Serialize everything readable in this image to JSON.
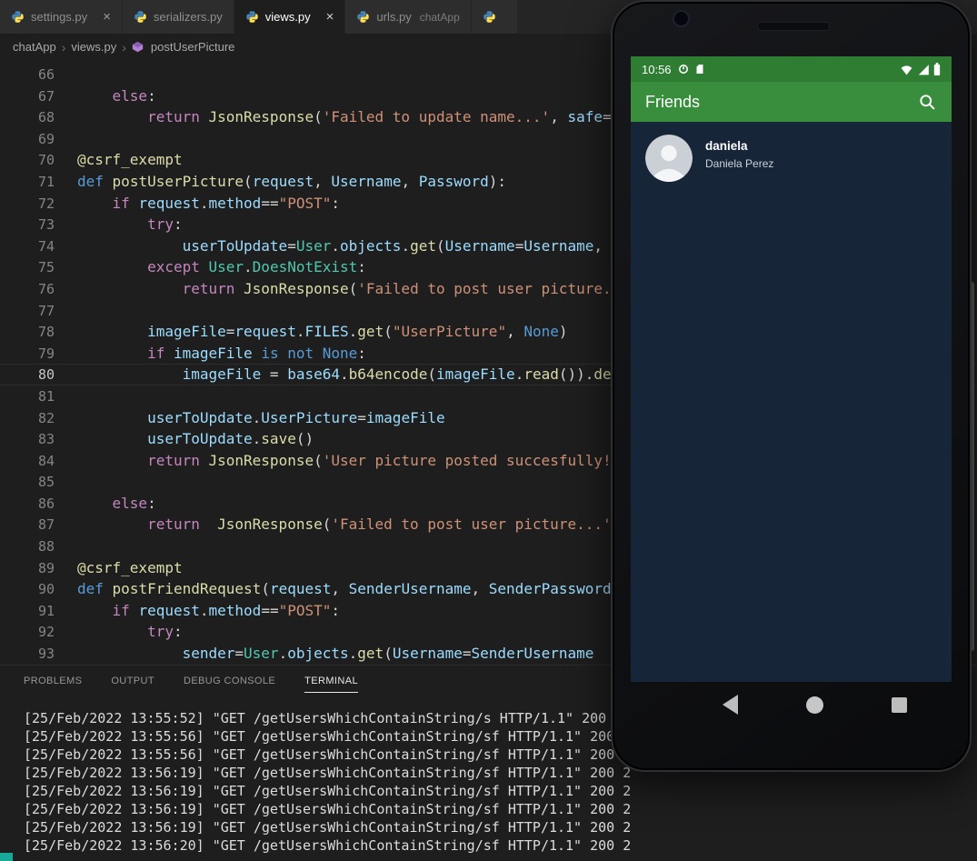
{
  "colors": {
    "editor_bg": "#1E1E1E",
    "tabbar_bg": "#252526",
    "inactive_tab_bg": "#2D2D2D",
    "phone_header_green": "#388E3C",
    "phone_status_green": "#2E7D32",
    "phone_screen_bg": "#172539",
    "terminal_text": "#DCDCDC",
    "status_accent_teal": "#18A999"
  },
  "tabs": [
    {
      "label": "settings.py",
      "active": false,
      "close": true
    },
    {
      "label": "serializers.py",
      "active": false,
      "close": false
    },
    {
      "label": "views.py",
      "active": true,
      "close": true
    },
    {
      "label": "urls.py",
      "hint": "chatApp",
      "active": false,
      "close": false
    },
    {
      "label": "",
      "active": false,
      "close": false
    }
  ],
  "breadcrumb": {
    "items": [
      "chatApp",
      "views.py",
      "postUserPicture"
    ]
  },
  "editor": {
    "current_line": 80,
    "token_colors": {
      "kw": "#C586C0",
      "def": "#569CD6",
      "fn": "#DCDCAA",
      "var": "#9CDCFE",
      "str": "#CE9178",
      "cls": "#4EC9B0",
      "plain": "#D4D4D4"
    },
    "lines": [
      {
        "num": 66,
        "tokens": []
      },
      {
        "num": 67,
        "tokens": [
          [
            "plain",
            "    "
          ],
          [
            "kw",
            "else"
          ],
          [
            "plain",
            ":"
          ]
        ]
      },
      {
        "num": 68,
        "tokens": [
          [
            "plain",
            "        "
          ],
          [
            "kw",
            "return"
          ],
          [
            "plain",
            " "
          ],
          [
            "fn",
            "JsonResponse"
          ],
          [
            "plain",
            "("
          ],
          [
            "str",
            "'Failed to update name...'"
          ],
          [
            "plain",
            ", "
          ],
          [
            "var",
            "safe"
          ],
          [
            "plain",
            "="
          ]
        ]
      },
      {
        "num": 69,
        "tokens": []
      },
      {
        "num": 70,
        "tokens": [
          [
            "fn",
            "@csrf_exempt"
          ]
        ]
      },
      {
        "num": 71,
        "tokens": [
          [
            "def",
            "def"
          ],
          [
            "plain",
            " "
          ],
          [
            "fn",
            "postUserPicture"
          ],
          [
            "plain",
            "("
          ],
          [
            "var",
            "request"
          ],
          [
            "plain",
            ", "
          ],
          [
            "var",
            "Username"
          ],
          [
            "plain",
            ", "
          ],
          [
            "var",
            "Password"
          ],
          [
            "plain",
            "):"
          ]
        ]
      },
      {
        "num": 72,
        "tokens": [
          [
            "plain",
            "    "
          ],
          [
            "kw",
            "if"
          ],
          [
            "plain",
            " "
          ],
          [
            "var",
            "request"
          ],
          [
            "plain",
            "."
          ],
          [
            "var",
            "method"
          ],
          [
            "plain",
            "=="
          ],
          [
            "str",
            "\"POST\""
          ],
          [
            "plain",
            ":"
          ]
        ]
      },
      {
        "num": 73,
        "tokens": [
          [
            "plain",
            "        "
          ],
          [
            "kw",
            "try"
          ],
          [
            "plain",
            ":"
          ]
        ]
      },
      {
        "num": 74,
        "tokens": [
          [
            "plain",
            "            "
          ],
          [
            "var",
            "userToUpdate"
          ],
          [
            "plain",
            "="
          ],
          [
            "cls",
            "User"
          ],
          [
            "plain",
            "."
          ],
          [
            "var",
            "objects"
          ],
          [
            "plain",
            "."
          ],
          [
            "fn",
            "get"
          ],
          [
            "plain",
            "("
          ],
          [
            "var",
            "Username"
          ],
          [
            "plain",
            "="
          ],
          [
            "var",
            "Username"
          ],
          [
            "plain",
            ","
          ]
        ]
      },
      {
        "num": 75,
        "tokens": [
          [
            "plain",
            "        "
          ],
          [
            "kw",
            "except"
          ],
          [
            "plain",
            " "
          ],
          [
            "cls",
            "User"
          ],
          [
            "plain",
            "."
          ],
          [
            "cls",
            "DoesNotExist"
          ],
          [
            "plain",
            ":"
          ]
        ]
      },
      {
        "num": 76,
        "tokens": [
          [
            "plain",
            "            "
          ],
          [
            "kw",
            "return"
          ],
          [
            "plain",
            " "
          ],
          [
            "fn",
            "JsonResponse"
          ],
          [
            "plain",
            "("
          ],
          [
            "str",
            "'Failed to post user picture."
          ]
        ]
      },
      {
        "num": 77,
        "tokens": []
      },
      {
        "num": 78,
        "tokens": [
          [
            "plain",
            "        "
          ],
          [
            "var",
            "imageFile"
          ],
          [
            "plain",
            "="
          ],
          [
            "var",
            "request"
          ],
          [
            "plain",
            "."
          ],
          [
            "var",
            "FILES"
          ],
          [
            "plain",
            "."
          ],
          [
            "fn",
            "get"
          ],
          [
            "plain",
            "("
          ],
          [
            "str",
            "\"UserPicture\""
          ],
          [
            "plain",
            ", "
          ],
          [
            "def",
            "None"
          ],
          [
            "plain",
            ")"
          ]
        ]
      },
      {
        "num": 79,
        "tokens": [
          [
            "plain",
            "        "
          ],
          [
            "kw",
            "if"
          ],
          [
            "plain",
            " "
          ],
          [
            "var",
            "imageFile"
          ],
          [
            "plain",
            " "
          ],
          [
            "def",
            "is"
          ],
          [
            "plain",
            " "
          ],
          [
            "def",
            "not"
          ],
          [
            "plain",
            " "
          ],
          [
            "def",
            "None"
          ],
          [
            "plain",
            ":"
          ]
        ]
      },
      {
        "num": 80,
        "tokens": [
          [
            "plain",
            "            "
          ],
          [
            "var",
            "imageFile"
          ],
          [
            "plain",
            " = "
          ],
          [
            "var",
            "base64"
          ],
          [
            "plain",
            "."
          ],
          [
            "fn",
            "b64encode"
          ],
          [
            "plain",
            "("
          ],
          [
            "var",
            "imageFile"
          ],
          [
            "plain",
            "."
          ],
          [
            "fn",
            "read"
          ],
          [
            "plain",
            "())."
          ],
          [
            "fn",
            "de"
          ]
        ]
      },
      {
        "num": 81,
        "tokens": []
      },
      {
        "num": 82,
        "tokens": [
          [
            "plain",
            "        "
          ],
          [
            "var",
            "userToUpdate"
          ],
          [
            "plain",
            "."
          ],
          [
            "var",
            "UserPicture"
          ],
          [
            "plain",
            "="
          ],
          [
            "var",
            "imageFile"
          ]
        ]
      },
      {
        "num": 83,
        "tokens": [
          [
            "plain",
            "        "
          ],
          [
            "var",
            "userToUpdate"
          ],
          [
            "plain",
            "."
          ],
          [
            "fn",
            "save"
          ],
          [
            "plain",
            "()"
          ]
        ]
      },
      {
        "num": 84,
        "tokens": [
          [
            "plain",
            "        "
          ],
          [
            "kw",
            "return"
          ],
          [
            "plain",
            " "
          ],
          [
            "fn",
            "JsonResponse"
          ],
          [
            "plain",
            "("
          ],
          [
            "str",
            "'User picture posted succesfully!"
          ]
        ]
      },
      {
        "num": 85,
        "tokens": []
      },
      {
        "num": 86,
        "tokens": [
          [
            "plain",
            "    "
          ],
          [
            "kw",
            "else"
          ],
          [
            "plain",
            ":"
          ]
        ]
      },
      {
        "num": 87,
        "tokens": [
          [
            "plain",
            "        "
          ],
          [
            "kw",
            "return"
          ],
          [
            "plain",
            "  "
          ],
          [
            "fn",
            "JsonResponse"
          ],
          [
            "plain",
            "("
          ],
          [
            "str",
            "'Failed to post user picture...'"
          ]
        ]
      },
      {
        "num": 88,
        "tokens": []
      },
      {
        "num": 89,
        "tokens": [
          [
            "fn",
            "@csrf_exempt"
          ]
        ]
      },
      {
        "num": 90,
        "tokens": [
          [
            "def",
            "def"
          ],
          [
            "plain",
            " "
          ],
          [
            "fn",
            "postFriendRequest"
          ],
          [
            "plain",
            "("
          ],
          [
            "var",
            "request"
          ],
          [
            "plain",
            ", "
          ],
          [
            "var",
            "SenderUsername"
          ],
          [
            "plain",
            ", "
          ],
          [
            "var",
            "SenderPassword"
          ]
        ]
      },
      {
        "num": 91,
        "tokens": [
          [
            "plain",
            "    "
          ],
          [
            "kw",
            "if"
          ],
          [
            "plain",
            " "
          ],
          [
            "var",
            "request"
          ],
          [
            "plain",
            "."
          ],
          [
            "var",
            "method"
          ],
          [
            "plain",
            "=="
          ],
          [
            "str",
            "\"POST\""
          ],
          [
            "plain",
            ":"
          ]
        ]
      },
      {
        "num": 92,
        "tokens": [
          [
            "plain",
            "        "
          ],
          [
            "kw",
            "try"
          ],
          [
            "plain",
            ":"
          ]
        ]
      },
      {
        "num": 93,
        "tokens": [
          [
            "plain",
            "            "
          ],
          [
            "var",
            "sender"
          ],
          [
            "plain",
            "="
          ],
          [
            "cls",
            "User"
          ],
          [
            "plain",
            "."
          ],
          [
            "var",
            "objects"
          ],
          [
            "plain",
            "."
          ],
          [
            "fn",
            "get"
          ],
          [
            "plain",
            "("
          ],
          [
            "var",
            "Username"
          ],
          [
            "plain",
            "="
          ],
          [
            "var",
            "SenderUsername"
          ]
        ]
      }
    ]
  },
  "panel": {
    "tabs": [
      {
        "label": "PROBLEMS",
        "active": false
      },
      {
        "label": "OUTPUT",
        "active": false
      },
      {
        "label": "DEBUG CONSOLE",
        "active": false
      },
      {
        "label": "TERMINAL",
        "active": true
      }
    ],
    "log": [
      "[25/Feb/2022 13:55:52] \"GET /getUsersWhichContainString/s HTTP/1.1\" 200",
      "[25/Feb/2022 13:55:56] \"GET /getUsersWhichContainString/sf HTTP/1.1\" 200",
      "[25/Feb/2022 13:55:56] \"GET /getUsersWhichContainString/sf HTTP/1.1\" 200",
      "[25/Feb/2022 13:56:19] \"GET /getUsersWhichContainString/sf HTTP/1.1\" 200 2",
      "[25/Feb/2022 13:56:19] \"GET /getUsersWhichContainString/sf HTTP/1.1\" 200 2",
      "[25/Feb/2022 13:56:19] \"GET /getUsersWhichContainString/sf HTTP/1.1\" 200 2",
      "[25/Feb/2022 13:56:19] \"GET /getUsersWhichContainString/sf HTTP/1.1\" 200 2",
      "[25/Feb/2022 13:56:20] \"GET /getUsersWhichContainString/sf HTTP/1.1\" 200 2"
    ]
  },
  "phone": {
    "status_bar": {
      "time": "10:56"
    },
    "header": {
      "title": "Friends"
    },
    "contact": {
      "username": "daniela",
      "full_name": "Daniela Perez"
    },
    "nav": [
      "back",
      "home",
      "recents"
    ]
  }
}
